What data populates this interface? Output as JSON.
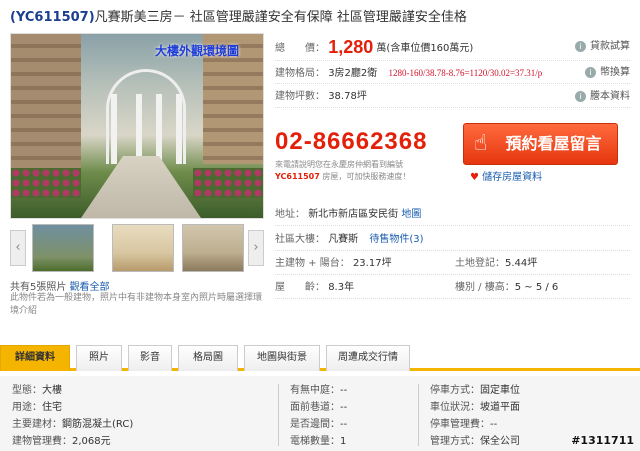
{
  "title": {
    "code": "(YC611507)",
    "text": "凡賽斯美三房－ 社區管理嚴謹安全有保障 社區管理嚴謹安全佳格"
  },
  "photo": {
    "caption": "大樓外觀環境圖"
  },
  "thumbs": {
    "prev": "‹",
    "next": "›"
  },
  "photo_count": {
    "text": "共有5張照片",
    "link": "觀看全部"
  },
  "photo_note": "此物件若為一般建物，照片中有非建物本身室內照片時屬選擇環境介紹",
  "price_row": {
    "label": "總　　價：",
    "value": "1,280",
    "unit": "萬(含車位價160萬元)",
    "link": "貸款試算"
  },
  "layout_row": {
    "label": "建物格局：",
    "value": "3房2廳2衛",
    "calc": "1280-160/38.78-8.76=1120/30.02=37.31/p",
    "link": "幣換算"
  },
  "area_row": {
    "label": "建物坪數：",
    "value": "38.78坪",
    "link": "謄本資料"
  },
  "phone": "02-86662368",
  "phone_note": {
    "line1": "來電請說明您在永慶房仲網看到編號",
    "code": "YC611507",
    "line2": "房屋，可加快服務速度！"
  },
  "book_button": "預約看屋留言",
  "save_link": "儲存房屋資料",
  "address": {
    "label": "地址：",
    "value": "新北市新店區安民街",
    "link": "地圖"
  },
  "community": {
    "label": "社區大樓：",
    "value": "凡賽斯",
    "link": "待售物件(3)"
  },
  "main_area": {
    "label": "主建物 + 陽台：",
    "value": "23.17坪"
  },
  "land": {
    "label": "土地登記：",
    "value": "5.44坪"
  },
  "age": {
    "label": "屋　　齡：",
    "value": "8.3年"
  },
  "floor": {
    "label": "樓別 / 樓高：",
    "value": "5 ~ 5 / 6"
  },
  "tabs": [
    "詳細資料",
    "照片",
    "影音",
    "格局圖",
    "地圖與街景",
    "周遭成交行情"
  ],
  "details": {
    "col1": [
      {
        "k": "型態：",
        "v": "大樓"
      },
      {
        "k": "用途：",
        "v": "住宅"
      },
      {
        "k": "主要建材：",
        "v": "鋼筋混凝土(RC)"
      },
      {
        "k": "建物管理費：",
        "v": "2,068元"
      }
    ],
    "col2": [
      {
        "k": "有無中庭：",
        "v": "--"
      },
      {
        "k": "面前巷道：",
        "v": "--"
      },
      {
        "k": "是否邊間：",
        "v": "--"
      },
      {
        "k": "電梯數量：",
        "v": "1"
      }
    ],
    "col3": [
      {
        "k": "停車方式：",
        "v": "固定車位"
      },
      {
        "k": "車位狀況：",
        "v": "坡道平面"
      },
      {
        "k": "停車管理費：",
        "v": "--"
      },
      {
        "k": "管理方式：",
        "v": "保全公司"
      }
    ]
  },
  "watermark": "#1311711",
  "colors": {
    "accent": "#e4200a",
    "tab_active": "#f4b400",
    "link": "#1a5cb0"
  }
}
